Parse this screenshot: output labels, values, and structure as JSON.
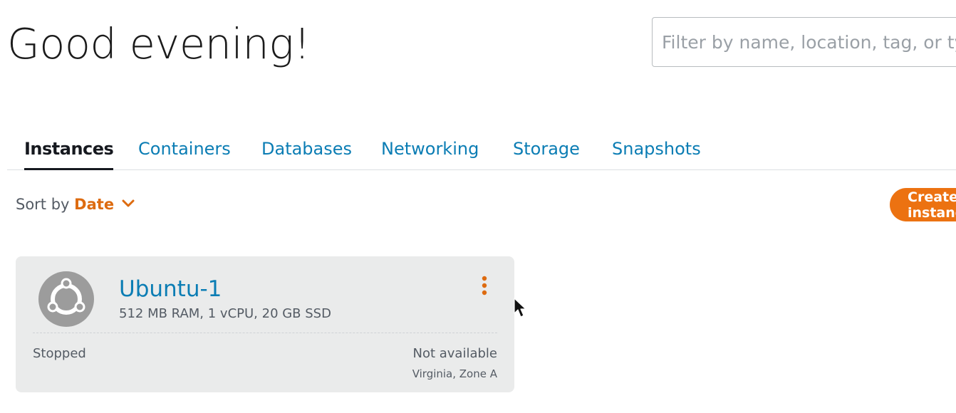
{
  "header": {
    "greeting": "Good evening!"
  },
  "search": {
    "placeholder": "Filter by name, location, tag, or type"
  },
  "tabs": [
    {
      "label": "Instances",
      "active": true
    },
    {
      "label": "Containers",
      "active": false
    },
    {
      "label": "Databases",
      "active": false
    },
    {
      "label": "Networking",
      "active": false
    },
    {
      "label": "Storage",
      "active": false
    },
    {
      "label": "Snapshots",
      "active": false
    }
  ],
  "sort": {
    "label": "Sort by",
    "value": "Date",
    "icon": "chevron-down-icon"
  },
  "create_button": {
    "label": "Create instance"
  },
  "instance": {
    "name": "Ubuntu-1",
    "specs": "512 MB RAM, 1 vCPU, 20 GB SSD",
    "status": "Stopped",
    "ip": "Not available",
    "location": "Virginia, Zone A",
    "os_icon": "ubuntu-logo-icon",
    "menu_icon": "kebab-menu-icon"
  },
  "colors": {
    "link": "#0b7db4",
    "accent": "#ec7211",
    "sort_accent": "#dd6b10",
    "card_bg": "#eaebeb",
    "text_muted": "#545b64"
  }
}
